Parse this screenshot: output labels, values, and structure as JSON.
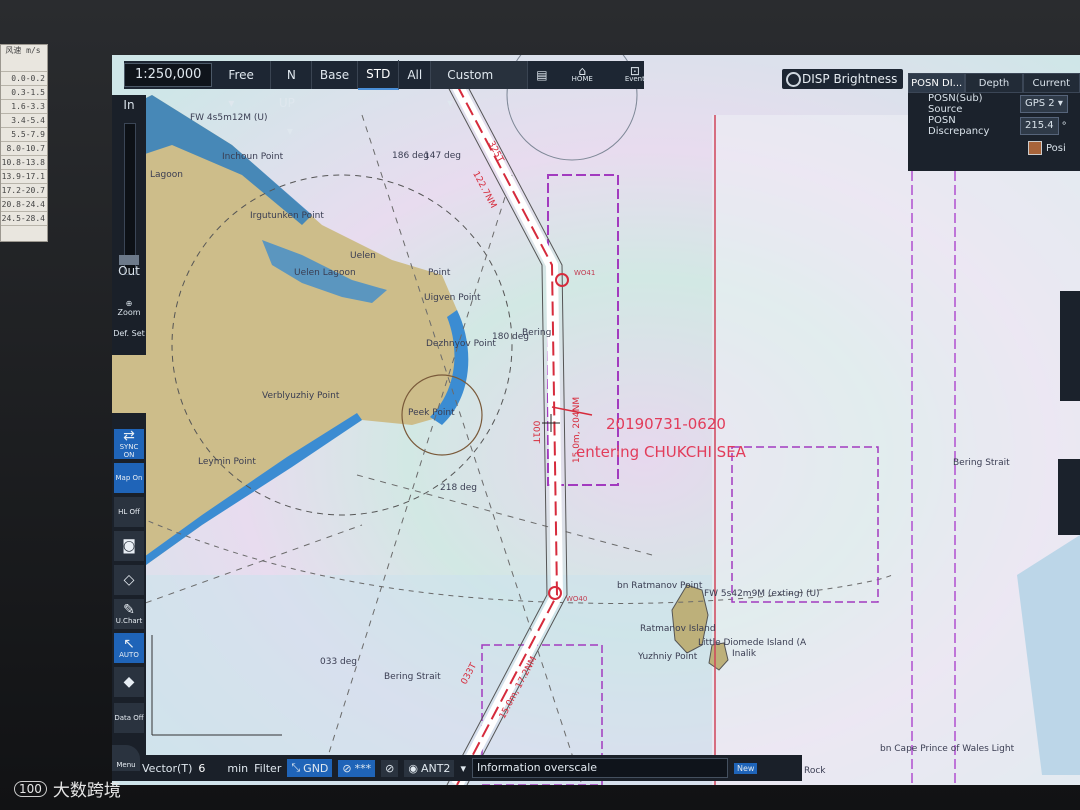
{
  "paper_table": {
    "header": "风速\nm/s",
    "rows": [
      "0.0-0.2",
      "0.3-1.5",
      "1.6-3.3",
      "3.4-5.4",
      "5.5-7.9",
      "8.0-10.7",
      "10.8-13.8",
      "13.9-17.1",
      "17.2-20.7",
      "20.8-24.4",
      "24.5-28.4"
    ]
  },
  "toolbar": {
    "scale": "1:250,000",
    "free": "Free",
    "orientation": "N UP",
    "base": "Base",
    "std": "STD",
    "all": "All",
    "custom": "Custom",
    "home_label": "HOME",
    "event_label": "Event"
  },
  "disp_brightness": "DISP Brightness",
  "posn_panel": {
    "tabs": [
      "POSN DI...",
      "Depth",
      "Current"
    ],
    "source_label": "POSN(Sub) Source",
    "source_value": "GPS 2",
    "discrepancy_label": "POSN Discrepancy",
    "discrepancy_value": "215.4",
    "unit": "°",
    "posi_label": "Posi"
  },
  "leftbar": {
    "in": "In",
    "out": "Out",
    "zoom": "Zoom",
    "def_set": "Def. Set",
    "sync": "SYNC ON",
    "map": "Map On",
    "hl": "HL Off",
    "uchart": "U.Chart",
    "auto": "AUTO",
    "data": "Data Off",
    "menu": "Menu"
  },
  "bottombar": {
    "vector_label": "Vector(T)",
    "vector_value": "6",
    "unit": "min",
    "filter": "Filter",
    "gnd": "GND",
    "stars": "***",
    "ant": "ANT2",
    "info": "Information overscale",
    "new": "New"
  },
  "map": {
    "labels": {
      "fw_top": "FW 4s5m12M (U)",
      "inchoun": "Inchoun Point",
      "lagoon": "Lagoon",
      "irgutunken": "Irgutunken Point",
      "uelen": "Uelen",
      "uelen_lagoon": "Uelen Lagoon",
      "point": "Point",
      "uigven": "Uigven Point",
      "dezhnyov": "Dezhnyov Point",
      "verblyuzhiy": "Verblyuzhiy Point",
      "peek": "Peek Point",
      "leymin": "Leymin Point",
      "bering": "Bering",
      "bering_strait_1": "Bering Strait",
      "bering_strait_2": "Bering Strait",
      "ratmanov_island": "Ratmanov Island",
      "little_diomede": "Little Diomede Island (A",
      "inalik": "Inalik",
      "yuzhniy": "Yuzhniy Point",
      "ratmanov_point": "bn Ratmanov Point",
      "fw_exting": "FW 5s42m9M (exting) (U)",
      "cape_prince": "bn Cape Prince of Wales Light",
      "rock": "Rock",
      "deg_186": "186 deg",
      "deg_147": "147 deg",
      "deg_180": "180 deg",
      "deg_218": "218 deg",
      "deg_033": "033 deg",
      "route_1": "122.7NM",
      "route_2": "325T",
      "route_3": "15.0m, 204NM",
      "route_4": "001T",
      "route_5": "15.0m, 17.2NM",
      "route_6": "033T",
      "wp_top": "WO41",
      "wp_bottom": "WO40"
    },
    "event_time": "20190731-0620",
    "event_text": "entering CHUKCHI SEA"
  },
  "watermark": {
    "logo": "100",
    "text": "大数跨境"
  }
}
